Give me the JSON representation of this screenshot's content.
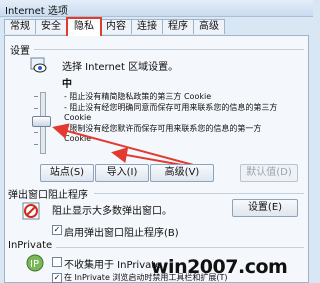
{
  "window": {
    "title": "Internet 选项"
  },
  "tabs": [
    {
      "label": "常规",
      "active": false
    },
    {
      "label": "安全",
      "active": false
    },
    {
      "label": "隐私",
      "active": true
    },
    {
      "label": "内容",
      "active": false
    },
    {
      "label": "连接",
      "active": false
    },
    {
      "label": "程序",
      "active": false
    },
    {
      "label": "高级",
      "active": false
    }
  ],
  "settings": {
    "group_label": "设置",
    "instruction": "选择 Internet 区域设置。",
    "level": "中",
    "slider_position": 0.6,
    "descriptions": [
      "- 阻止没有精简隐私政策的第三方 Cookie",
      "- 阻止没有经您明确同意而保存可用来联系您的信息的第三方 Cookie",
      "- 限制没有经您默许而保存可用来联系您的信息的第一方 Cookie"
    ],
    "buttons": {
      "sites": "站点(S)",
      "import": "导入(I)",
      "advanced": "高级(V)",
      "default": "默认值(D)"
    }
  },
  "popup": {
    "group_label": "弹出窗口阻止程序",
    "description": "阻止显示大多数弹出窗口。",
    "settings_button": "设置(E)",
    "enable_label": "启用弹出窗口阻止程序(B)",
    "enable_checked": true
  },
  "inprivate": {
    "group_label": "InPrivate",
    "option1": "不收集用于 InPrivate",
    "option1_checked": false,
    "option2": "在 InPrivate 浏览启动时禁用工具栏和扩展(T)",
    "option2_checked": true
  },
  "watermark": "win2007.com",
  "colors": {
    "highlight": "#e23a2e",
    "accent": "#1f5fbf"
  }
}
